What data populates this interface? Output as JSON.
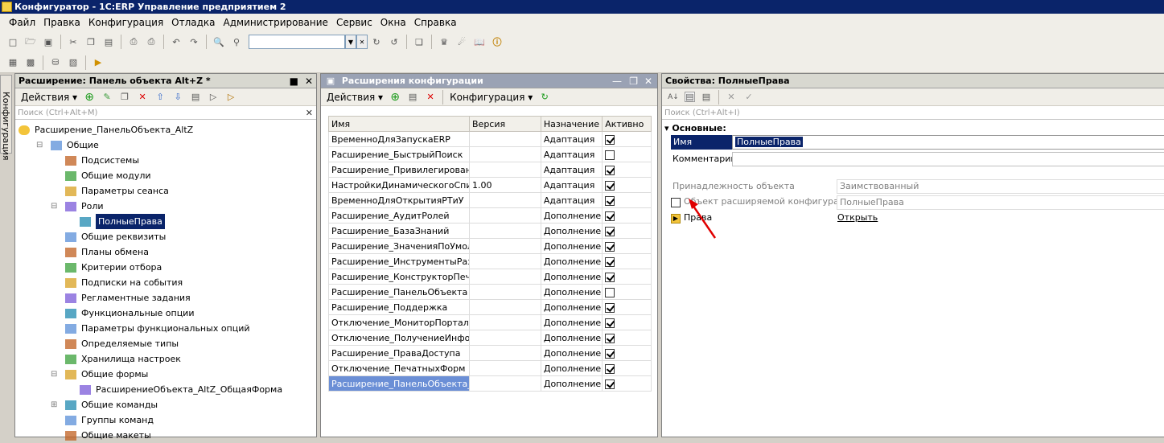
{
  "window": {
    "title": "Конфигуратор - 1С:ERP Управление предприятием 2"
  },
  "menu": [
    "Файл",
    "Правка",
    "Конфигурация",
    "Отладка",
    "Администрирование",
    "Сервис",
    "Окна",
    "Справка"
  ],
  "vertical_tab": {
    "label": "Конфигурация"
  },
  "left_panel": {
    "title": "Расширение: Панель объекта Alt+Z *",
    "actions_label": "Действия",
    "search_placeholder": "Поиск (Ctrl+Alt+M)",
    "root": "Расширение_ПанельОбъекта_AltZ",
    "items": [
      {
        "label": "Общие",
        "level": 1,
        "icon": "common-icon",
        "exp": "minus"
      },
      {
        "label": "Подсистемы",
        "level": 2,
        "icon": "subsystems-icon"
      },
      {
        "label": "Общие модули",
        "level": 2,
        "icon": "modules-icon"
      },
      {
        "label": "Параметры сеанса",
        "level": 2,
        "icon": "session-params-icon"
      },
      {
        "label": "Роли",
        "level": 2,
        "icon": "roles-icon",
        "exp": "minus"
      },
      {
        "label": "ПолныеПрава",
        "level": 3,
        "icon": "role-icon",
        "selected": true
      },
      {
        "label": "Общие реквизиты",
        "level": 2,
        "icon": "attributes-icon"
      },
      {
        "label": "Планы обмена",
        "level": 2,
        "icon": "exchange-plans-icon"
      },
      {
        "label": "Критерии отбора",
        "level": 2,
        "icon": "filter-criteria-icon"
      },
      {
        "label": "Подписки на события",
        "level": 2,
        "icon": "event-subscriptions-icon"
      },
      {
        "label": "Регламентные задания",
        "level": 2,
        "icon": "scheduled-jobs-icon"
      },
      {
        "label": "Функциональные опции",
        "level": 2,
        "icon": "functional-options-icon"
      },
      {
        "label": "Параметры функциональных опций",
        "level": 2,
        "icon": "fo-params-icon"
      },
      {
        "label": "Определяемые типы",
        "level": 2,
        "icon": "defined-types-icon"
      },
      {
        "label": "Хранилища настроек",
        "level": 2,
        "icon": "settings-storage-icon"
      },
      {
        "label": "Общие формы",
        "level": 2,
        "icon": "forms-icon",
        "exp": "minus"
      },
      {
        "label": "РасширениеОбъекта_AltZ_ОбщаяФорма",
        "level": 3,
        "icon": "form-icon"
      },
      {
        "label": "Общие команды",
        "level": 2,
        "icon": "commands-icon",
        "exp": "plus"
      },
      {
        "label": "Группы команд",
        "level": 2,
        "icon": "command-groups-icon"
      },
      {
        "label": "Общие макеты",
        "level": 2,
        "icon": "templates-icon"
      }
    ]
  },
  "middle_panel": {
    "title": "Расширения конфигурации",
    "actions_label": "Действия",
    "config_label": "Конфигурация",
    "columns": [
      "Имя",
      "Версия",
      "Назначение",
      "Активно"
    ],
    "rows": [
      {
        "name": "ВременноДляЗапускаERP",
        "version": "",
        "purpose": "Адаптация",
        "active": true
      },
      {
        "name": "Расширение_БыстрыйПоиск",
        "version": "",
        "purpose": "Адаптация",
        "active": false
      },
      {
        "name": "Расширение_Привилегированн...",
        "version": "",
        "purpose": "Адаптация",
        "active": true
      },
      {
        "name": "НастройкиДинамическогоСпис...",
        "version": "1.00",
        "purpose": "Адаптация",
        "active": true
      },
      {
        "name": "ВременноДляОткрытияРТиУ",
        "version": "",
        "purpose": "Адаптация",
        "active": true
      },
      {
        "name": "Расширение_АудитРолей",
        "version": "",
        "purpose": "Дополнение",
        "active": true
      },
      {
        "name": "Расширение_БазаЗнаний",
        "version": "",
        "purpose": "Дополнение",
        "active": true
      },
      {
        "name": "Расширение_ЗначенияПоУмол...",
        "version": "",
        "purpose": "Дополнение",
        "active": true
      },
      {
        "name": "Расширение_ИнструментыРаз...",
        "version": "",
        "purpose": "Дополнение",
        "active": true
      },
      {
        "name": "Расширение_КонструкторПеча...",
        "version": "",
        "purpose": "Дополнение",
        "active": true
      },
      {
        "name": "Расширение_ПанельОбъекта",
        "version": "",
        "purpose": "Дополнение",
        "active": false
      },
      {
        "name": "Расширение_Поддержка",
        "version": "",
        "purpose": "Дополнение",
        "active": true
      },
      {
        "name": "Отключение_МониторПортала1...",
        "version": "",
        "purpose": "Дополнение",
        "active": true
      },
      {
        "name": "Отключение_ПолучениеИнфор...",
        "version": "",
        "purpose": "Дополнение",
        "active": true
      },
      {
        "name": "Расширение_ПраваДоступа",
        "version": "",
        "purpose": "Дополнение",
        "active": true
      },
      {
        "name": "Отключение_ПечатныхФорм",
        "version": "",
        "purpose": "Дополнение",
        "active": true
      },
      {
        "name": "Расширение_ПанельОбъекта_...",
        "version": "",
        "purpose": "Дополнение",
        "active": true,
        "selected": true
      }
    ]
  },
  "right_panel": {
    "title": "Свойства: ПолныеПрава",
    "search_placeholder": "Поиск (Ctrl+Alt+I)",
    "section": "Основные:",
    "name_label": "Имя",
    "name_value": "ПолныеПрава",
    "comment_label": "Комментарий",
    "comment_value": "",
    "ownership_label": "Принадлежность объекта",
    "ownership_value": "Заимствованный",
    "extended_label": "Объект расширяемой конфигурации",
    "extended_value": "ПолныеПрава",
    "rights_label": "Права",
    "rights_link": "Открыть"
  },
  "colors": {
    "selection": "#0a246a",
    "row_selection": "#6b8fd6",
    "annotation_arrow": "#e00000"
  }
}
